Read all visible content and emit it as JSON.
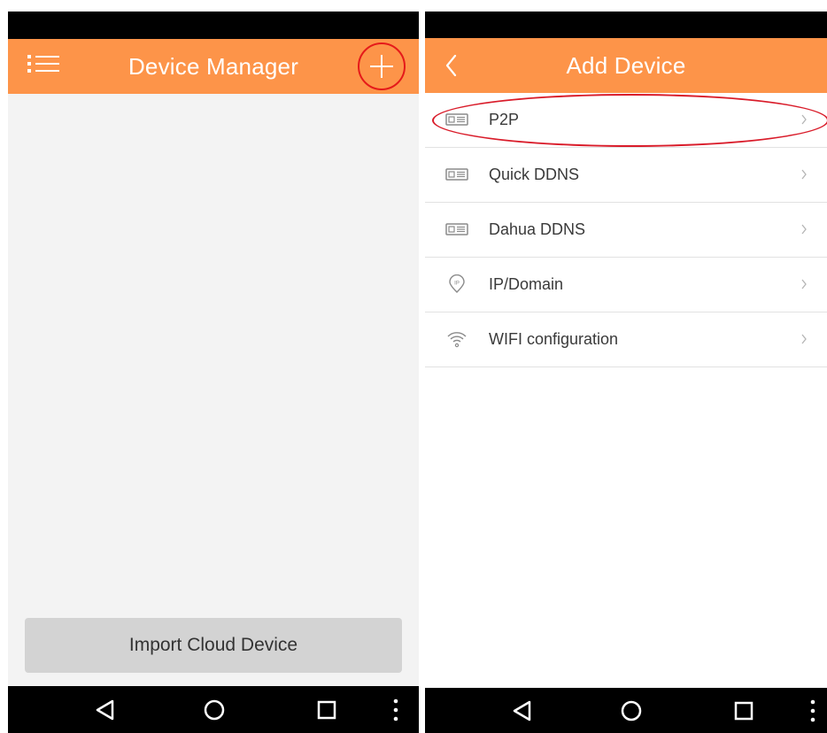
{
  "left_screen": {
    "title": "Device Manager",
    "icons": {
      "menu": "menu-list-icon",
      "add": "plus-icon"
    },
    "import_button_label": "Import Cloud Device"
  },
  "right_screen": {
    "title": "Add Device",
    "icons": {
      "back": "chevron-left-icon"
    },
    "items": [
      {
        "label": "P2P",
        "icon": "device-card-icon"
      },
      {
        "label": "Quick DDNS",
        "icon": "device-card-icon"
      },
      {
        "label": "Dahua DDNS",
        "icon": "device-card-icon"
      },
      {
        "label": "IP/Domain",
        "icon": "ip-pin-icon"
      },
      {
        "label": "WIFI configuration",
        "icon": "wifi-icon"
      }
    ]
  },
  "colors": {
    "app_bar": "#fd9449",
    "annotation_red": "#e51a1a",
    "background": "#f3f3f3",
    "import_button": "#d3d3d3"
  },
  "navigation": {
    "icons": [
      "back-triangle-icon",
      "home-circle-icon",
      "recent-apps-square-icon",
      "more-dots-icon"
    ]
  }
}
